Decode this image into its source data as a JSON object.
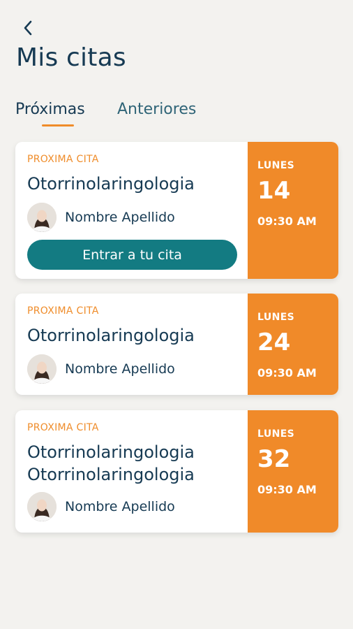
{
  "header": {
    "title": "Mis citas"
  },
  "tabs": [
    {
      "label": "Próximas",
      "active": true
    },
    {
      "label": "Anteriores",
      "active": false
    }
  ],
  "colors": {
    "accent": "#f08a29",
    "primary_text": "#163a53",
    "button": "#137b82",
    "background": "#f3f2ef"
  },
  "appointments": [
    {
      "eyebrow": "PROXIMA CITA",
      "specialty": "Otorrinolaringologia",
      "doctor": "Nombre Apellido",
      "day_name": "LUNES",
      "day_number": "14",
      "time": "09:30 AM",
      "cta_label": "Entrar a tu cita"
    },
    {
      "eyebrow": "PROXIMA CITA",
      "specialty": "Otorrinolaringologia",
      "doctor": "Nombre Apellido",
      "day_name": "LUNES",
      "day_number": "24",
      "time": "09:30 AM"
    },
    {
      "eyebrow": "PROXIMA CITA",
      "specialty": "Otorrinolaringologia Otorrinolaringologia",
      "doctor": "Nombre Apellido",
      "day_name": "LUNES",
      "day_number": "32",
      "time": "09:30 AM"
    }
  ],
  "icons": {
    "back": "chevron-left-icon",
    "avatar": "doctor-avatar"
  }
}
